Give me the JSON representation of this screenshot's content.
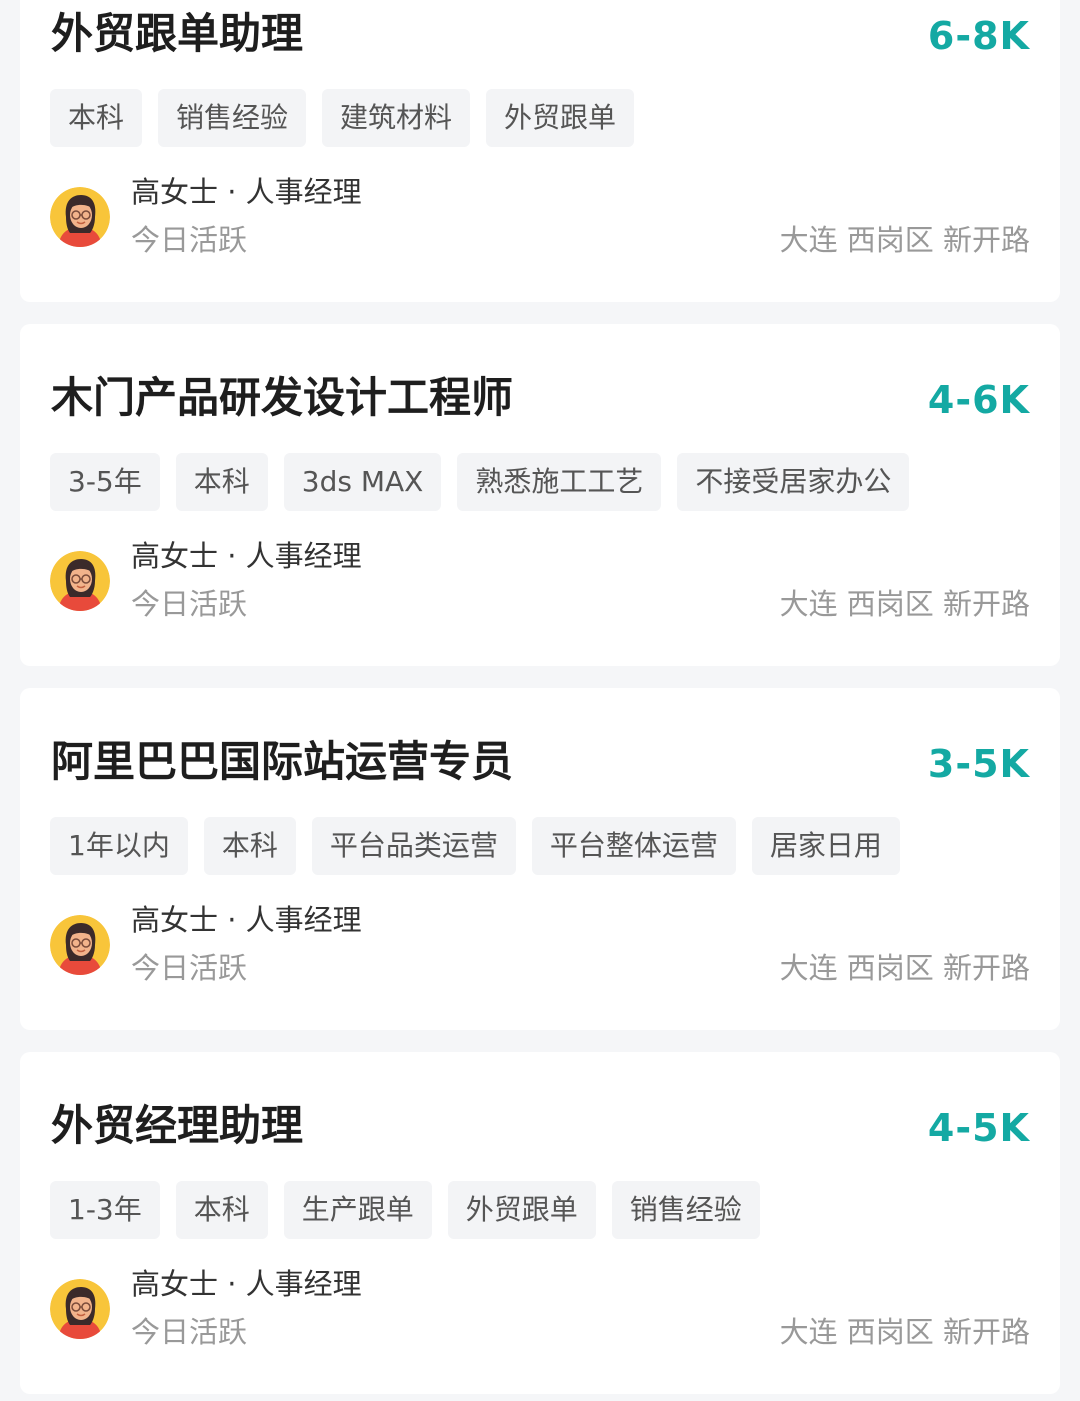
{
  "jobs": [
    {
      "title": "外贸跟单助理",
      "salary": "6-8K",
      "tags": [
        "本科",
        "销售经验",
        "建筑材料",
        "外贸跟单"
      ],
      "recruiter": "高女士 · 人事经理",
      "status": "今日活跃",
      "location": "大连 西岗区 新开路"
    },
    {
      "title": "木门产品研发设计工程师",
      "salary": "4-6K",
      "tags": [
        "3-5年",
        "本科",
        "3ds MAX",
        "熟悉施工工艺",
        "不接受居家办公"
      ],
      "recruiter": "高女士 · 人事经理",
      "status": "今日活跃",
      "location": "大连 西岗区 新开路"
    },
    {
      "title": "阿里巴巴国际站运营专员",
      "salary": "3-5K",
      "tags": [
        "1年以内",
        "本科",
        "平台品类运营",
        "平台整体运营",
        "居家日用"
      ],
      "recruiter": "高女士 · 人事经理",
      "status": "今日活跃",
      "location": "大连 西岗区 新开路"
    },
    {
      "title": "外贸经理助理",
      "salary": "4-5K",
      "tags": [
        "1-3年",
        "本科",
        "生产跟单",
        "外贸跟单",
        "销售经验"
      ],
      "recruiter": "高女士 · 人事经理",
      "status": "今日活跃",
      "location": "大连 西岗区 新开路"
    }
  ],
  "colors": {
    "salary": "#14a9a3",
    "background": "#f5f6f8",
    "card": "#ffffff",
    "tag_bg": "#f3f4f6"
  },
  "icons": {
    "avatar": "recruiter-avatar-woman-with-glasses"
  }
}
